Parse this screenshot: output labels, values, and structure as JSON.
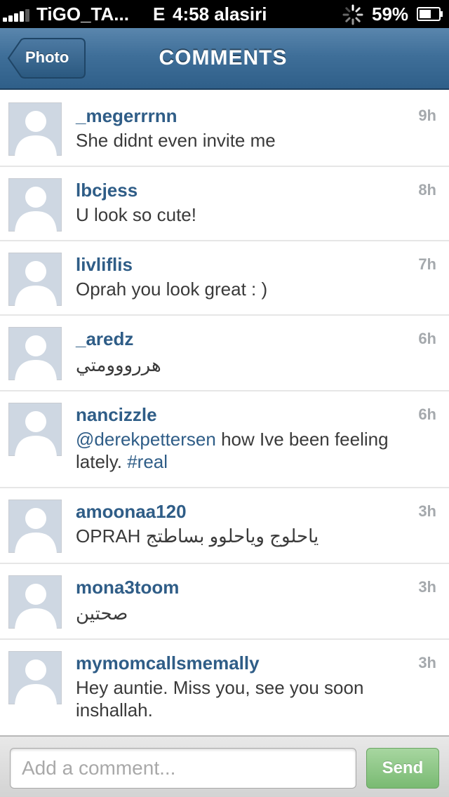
{
  "status_bar": {
    "carrier": "TiGO_TA...",
    "network": "E",
    "time": "4:58 alasiri",
    "battery_percent": "59%",
    "icons": [
      "signal-icon",
      "activity-spinner-icon",
      "battery-icon"
    ]
  },
  "nav": {
    "back_label": "Photo",
    "title": "COMMENTS"
  },
  "comments": [
    {
      "username": "_megerrrnn",
      "time": "9h",
      "text": "She didnt even invite me"
    },
    {
      "username": "lbcjess",
      "time": "8h",
      "text": "U look so cute!"
    },
    {
      "username": "livliflis",
      "time": "7h",
      "text": "Oprah you look great : )"
    },
    {
      "username": "_aredz",
      "time": "6h",
      "text": "هررووومتي"
    },
    {
      "username": "nancizzle",
      "time": "6h",
      "mention": "@derekpettersen",
      "text_after_mention": " how Ive been feeling lately. ",
      "hashtag": "#real"
    },
    {
      "username": "amoonaa120",
      "time": "3h",
      "text": "OPRAH  ياحلوج  وياحلوو بساطتج"
    },
    {
      "username": "mona3toom",
      "time": "3h",
      "text": "صحتين"
    },
    {
      "username": "mymomcallsmemally",
      "time": "3h",
      "text": "Hey auntie.  Miss you, see you soon inshallah."
    }
  ],
  "composer": {
    "placeholder": "Add a comment...",
    "send_label": "Send"
  },
  "colors": {
    "nav_blue": "#3f6f99",
    "username_blue": "#2f5d87",
    "send_green": "#79ba72",
    "avatar_bg": "#ced7e2"
  }
}
